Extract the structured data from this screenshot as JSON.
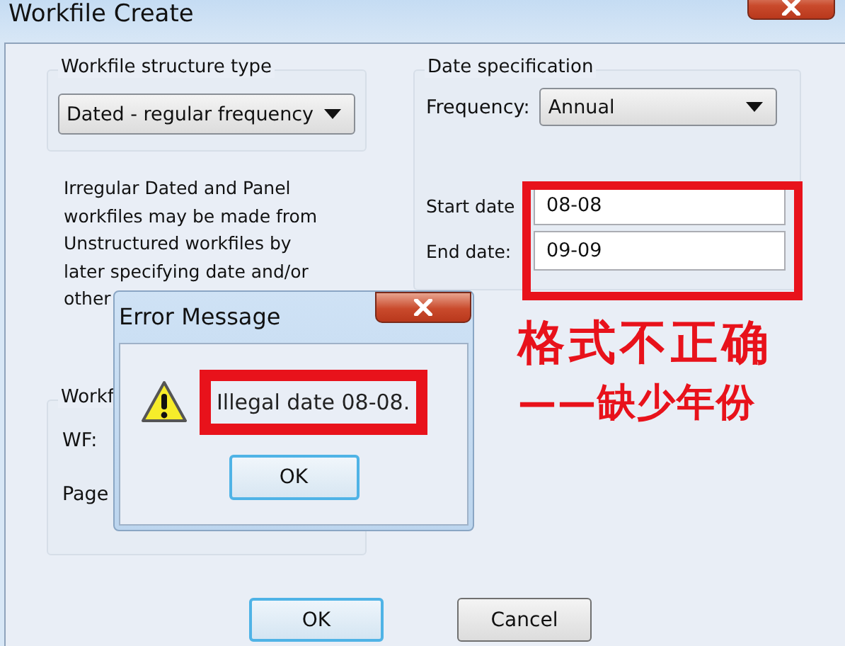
{
  "window": {
    "title": "Workfile Create"
  },
  "structure_group": {
    "title": "Workfile structure type",
    "dropdown": {
      "value": "Dated - regular frequency"
    }
  },
  "description": "Irregular Dated and Panel\nworkfiles may be made from\nUnstructured workfiles by\nlater specifying date and/or\nother",
  "names_group": {
    "title": "Workf",
    "fields": [
      {
        "label": "WF:"
      },
      {
        "label": "Page"
      }
    ]
  },
  "date_group": {
    "title": "Date specification",
    "frequency": {
      "label": "Frequency:",
      "value": "Annual"
    },
    "fields": [
      {
        "label": "Start date",
        "value": "08-08"
      },
      {
        "label": "End date:",
        "value": "09-09"
      }
    ]
  },
  "buttons": [
    {
      "label": "OK",
      "default": true
    },
    {
      "label": "Cancel",
      "default": false
    }
  ],
  "error_dialog": {
    "title": "Error Message",
    "message": "Illegal date 08-08.",
    "button": "OK"
  },
  "annotations": [
    {
      "text": "格式不正确"
    },
    {
      "text": "——缺少年份"
    }
  ]
}
